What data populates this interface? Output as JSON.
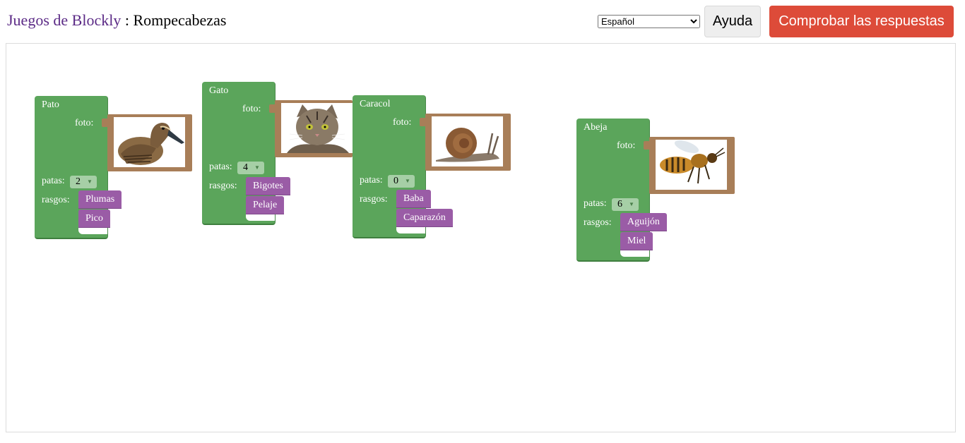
{
  "header": {
    "title_link": "Juegos de Blockly",
    "title_sep": " : ",
    "title_page": "Rompecabezas",
    "language": {
      "selected": "Español"
    },
    "help_label": "Ayuda",
    "check_label": "Comprobar las respuestas",
    "colors": {
      "check_button": "#dd4b39",
      "help_button": "#eeeeee",
      "title_link": "#5b2a86"
    }
  },
  "labels": {
    "foto": "foto:",
    "patas": "patas:",
    "rasgos": "rasgos:"
  },
  "colors": {
    "animal_block": "#5ba55b",
    "picture_frame": "#a87e58",
    "trait_block": "#9a5ca6"
  },
  "blocks": [
    {
      "name": "Pato",
      "legs": "2",
      "picture": "duck-photo",
      "traits": [
        "Plumas",
        "Pico"
      ]
    },
    {
      "name": "Gato",
      "legs": "4",
      "picture": "cat-photo",
      "traits": [
        "Bigotes",
        "Pelaje"
      ]
    },
    {
      "name": "Caracol",
      "legs": "0",
      "picture": "snail-photo",
      "traits": [
        "Baba",
        "Caparazón"
      ]
    },
    {
      "name": "Abeja",
      "legs": "6",
      "picture": "bee-photo",
      "traits": [
        "Aguijón",
        "Miel"
      ]
    }
  ]
}
